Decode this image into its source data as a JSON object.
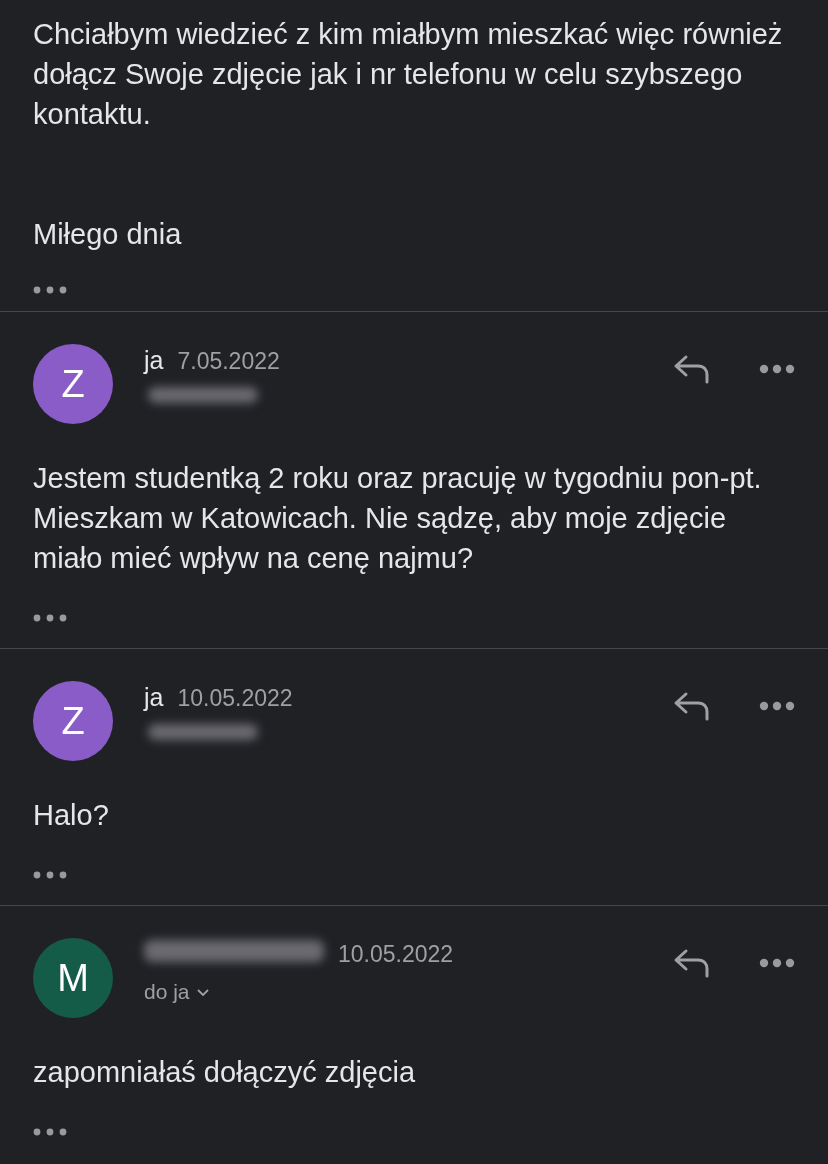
{
  "top_message": {
    "paragraphs": [
      "Chciałbym wiedzieć z kim miałbym mieszkać więc również dołącz Swoje zdjęcie jak i nr telefonu w celu szybszego kontaktu.",
      "Miłego dnia"
    ]
  },
  "messages": [
    {
      "kind": "sent",
      "avatar_letter": "Z",
      "color": "#8a5cc8",
      "sender": "ja",
      "date": "7.05.2022",
      "body": "Jestem studentką 2 roku oraz pracuję w tygodniu pon-pt. Mieszkam w Katowicach. Nie sądzę, aby moje zdjęcie miało mieć wpływ na cenę najmu?"
    },
    {
      "kind": "sent",
      "avatar_letter": "Z",
      "color": "#8a5cc8",
      "sender": "ja",
      "date": "10.05.2022",
      "body": "Halo?"
    },
    {
      "kind": "received",
      "avatar_letter": "M",
      "color": "#145c48",
      "recipient": "do ja",
      "date": "10.05.2022",
      "body": "zapomniałaś dołączyć zdjęcia"
    }
  ]
}
